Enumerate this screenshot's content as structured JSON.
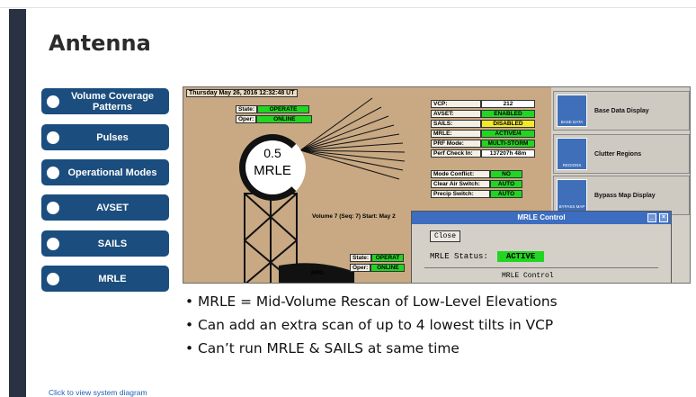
{
  "slide": {
    "title": "Antenna",
    "footer_link": "Click to view system diagram"
  },
  "nav": [
    {
      "label": "Volume Coverage Patterns"
    },
    {
      "label": "Pulses"
    },
    {
      "label": "Operational Modes"
    },
    {
      "label": "AVSET"
    },
    {
      "label": "SAILS"
    },
    {
      "label": "MRLE"
    }
  ],
  "screenshot": {
    "date": "Thursday May 26, 2016  12:32:48 UT",
    "state_label": "State:",
    "state_value": "OPERATE",
    "oper_label": "Oper:",
    "oper_value": "ONLINE",
    "tilt_angle": "0.5",
    "tilt_mode": "MRLE",
    "volume_text": "Volume 7 (Seq: 7) Start: May 2",
    "rpg_label": "RPG",
    "state2_label": "State:",
    "state2_value": "OPERAT",
    "oper2_label": "Oper:",
    "oper2_value": "ONLINE",
    "status": [
      {
        "k": "VCP:",
        "v": "212",
        "color": "white"
      },
      {
        "k": "AVSET:",
        "v": "ENABLED",
        "color": "green"
      },
      {
        "k": "SAILS:",
        "v": "DISABLED",
        "color": "yellow"
      },
      {
        "k": "MRLE:",
        "v": "ACTIVE/4",
        "color": "green"
      },
      {
        "k": "PRF Mode:",
        "v": "MULTI-STORM",
        "color": "green"
      },
      {
        "k": "Perf Check In:",
        "v": "137207h 48m",
        "color": "white"
      }
    ],
    "switches": [
      {
        "k": "Mode Conflict:",
        "v": "NO"
      },
      {
        "k": "Clear Air Switch:",
        "v": "AUTO"
      },
      {
        "k": "Precip Switch:",
        "v": "AUTO"
      }
    ],
    "side_items": [
      {
        "thumb": "BASE DATA",
        "label": "Base Data Display"
      },
      {
        "thumb": "REGIONS",
        "label": "Clutter Regions"
      },
      {
        "thumb": "BYPASS MAP",
        "label": "Bypass Map Display"
      }
    ],
    "dialog": {
      "title": "MRLE Control",
      "close": "Close",
      "status_label": "MRLE Status:",
      "status_value": "ACTIVE",
      "control_label": "MRLE Control"
    }
  },
  "bullets": [
    "MRLE = Mid-Volume Rescan of Low-Level Elevations",
    "Can add an extra scan of up to 4 lowest tilts in VCP",
    "Can’t run MRLE & SAILS at same time"
  ]
}
